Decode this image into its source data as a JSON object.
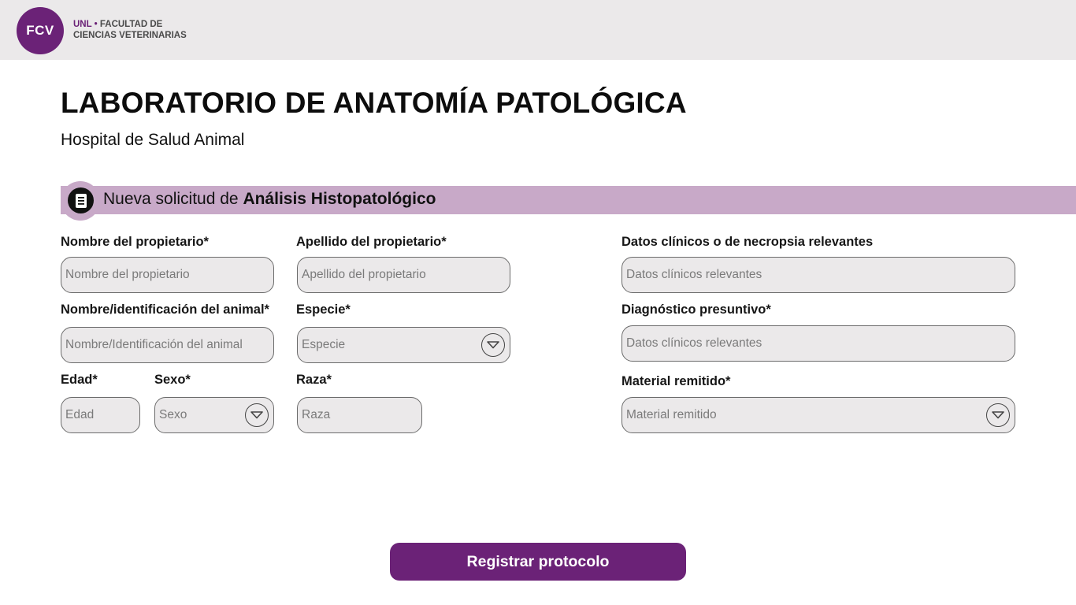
{
  "header": {
    "logo_initials": "FCV",
    "logo_unl": "UNL",
    "logo_dot": "•",
    "logo_line1": "FACULTAD DE",
    "logo_line2": "CIENCIAS VETERINARIAS"
  },
  "page": {
    "title": "LABORATORIO DE ANATOMÍA PATOLÓGICA",
    "subtitle": "Hospital de Salud Animal"
  },
  "section": {
    "icon": "document-icon",
    "title_prefix": "Nueva solicitud de ",
    "title_bold": "Análisis Histopatológico"
  },
  "form": {
    "owner_first_name": {
      "label": "Nombre del propietario*",
      "placeholder": "Nombre del propietario",
      "value": ""
    },
    "owner_last_name": {
      "label": "Apellido del propietario*",
      "placeholder": "Apellido del propietario",
      "value": ""
    },
    "animal_id": {
      "label": "Nombre/identificación del animal*",
      "placeholder": "Nombre/Identificación del animal",
      "value": ""
    },
    "species": {
      "label": "Especie*",
      "placeholder": "Especie",
      "icon": "chevron-down-icon"
    },
    "age": {
      "label": "Edad*",
      "placeholder": "Edad",
      "value": ""
    },
    "sex": {
      "label": "Sexo*",
      "placeholder": "Sexo",
      "icon": "chevron-down-icon"
    },
    "breed": {
      "label": "Raza*",
      "placeholder": "Raza",
      "value": ""
    },
    "clinical_data": {
      "label": "Datos clínicos o de necropsia relevantes",
      "placeholder": "Datos clínicos relevantes",
      "value": ""
    },
    "presumptive_diagnosis": {
      "label": "Diagnóstico presuntivo*",
      "placeholder": "Datos clínicos relevantes",
      "value": ""
    },
    "material": {
      "label": "Material remitido*",
      "placeholder": "Material remitido",
      "icon": "chevron-down-icon"
    }
  },
  "actions": {
    "submit_label": "Registrar protocolo"
  },
  "colors": {
    "brand": "#6b2277",
    "section_band": "#c8a9c8",
    "header_bg": "#ebe9ea",
    "field_bg": "#ebe9ea"
  }
}
